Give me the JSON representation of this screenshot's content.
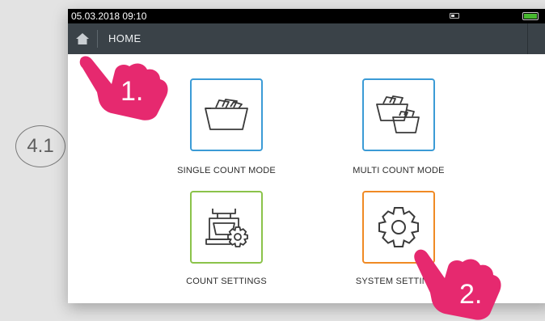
{
  "step_marker": "4.1",
  "status_bar": {
    "datetime": "05.03.2018  09:10"
  },
  "nav": {
    "title": "HOME"
  },
  "tiles": [
    {
      "label": "SINGLE COUNT MODE",
      "color": "#3b9bd6",
      "icon": "single-tray-icon"
    },
    {
      "label": "MULTI COUNT MODE",
      "color": "#3b9bd6",
      "icon": "multi-tray-icon"
    },
    {
      "label": "COUNT SETTINGS",
      "color": "#8bc34a",
      "icon": "scale-gear-icon"
    },
    {
      "label": "SYSTEM SETTINGS",
      "color": "#f08a24",
      "icon": "gear-icon"
    }
  ],
  "callouts": [
    {
      "label": "1.",
      "color": "#e6296f"
    },
    {
      "label": "2.",
      "color": "#e6296f"
    }
  ],
  "colors": {
    "battery": "#47b82f",
    "navbar": "#3a4248",
    "accent": "#e6296f"
  }
}
